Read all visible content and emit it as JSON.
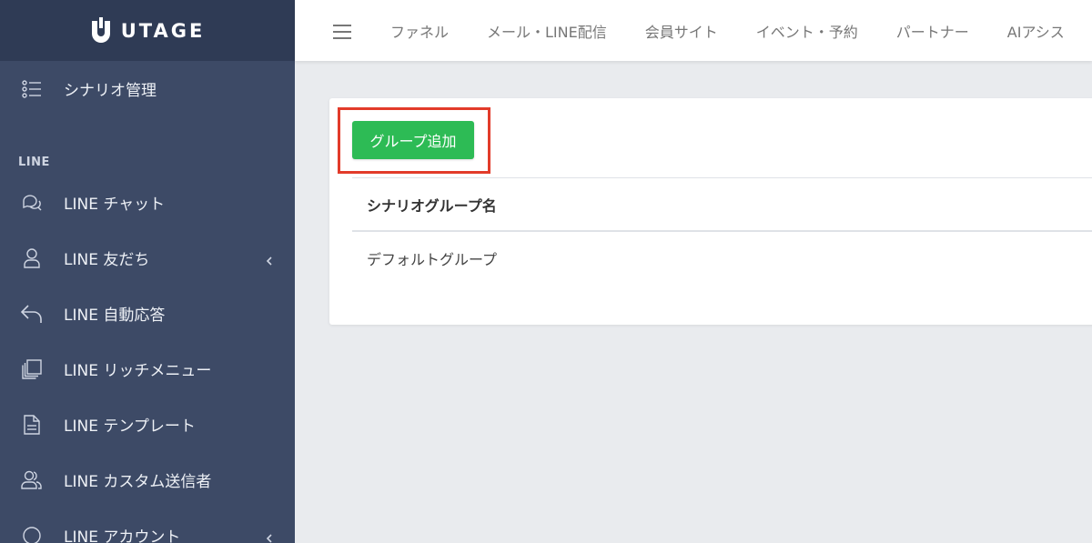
{
  "brand": {
    "name": "UTAGE"
  },
  "sidebar": {
    "top_item": {
      "label": "シナリオ管理",
      "icon": "list-icon"
    },
    "section_title": "LINE",
    "items": [
      {
        "label": "LINE チャット",
        "icon": "chat-icon",
        "has_chevron": false
      },
      {
        "label": "LINE 友だち",
        "icon": "user-icon",
        "has_chevron": true
      },
      {
        "label": "LINE 自動応答",
        "icon": "reply-icon",
        "has_chevron": false
      },
      {
        "label": "LINE リッチメニュー",
        "icon": "layers-icon",
        "has_chevron": false
      },
      {
        "label": "LINE テンプレート",
        "icon": "document-icon",
        "has_chevron": false
      },
      {
        "label": "LINE カスタム送信者",
        "icon": "users-icon",
        "has_chevron": false
      },
      {
        "label": "LINE アカウント",
        "icon": "circle-icon",
        "has_chevron": true
      }
    ]
  },
  "topnav": {
    "tabs": [
      "ファネル",
      "メール・LINE配信",
      "会員サイト",
      "イベント・予約",
      "パートナー",
      "AIアシス"
    ]
  },
  "card": {
    "add_button_label": "グループ追加",
    "table": {
      "header": "シナリオグループ名",
      "rows": [
        "デフォルトグループ"
      ]
    }
  },
  "colors": {
    "sidebar": "#3d4a66",
    "logo_bar": "#2f3b55",
    "button": "#2dbb55",
    "highlight": "#e23b2a"
  }
}
